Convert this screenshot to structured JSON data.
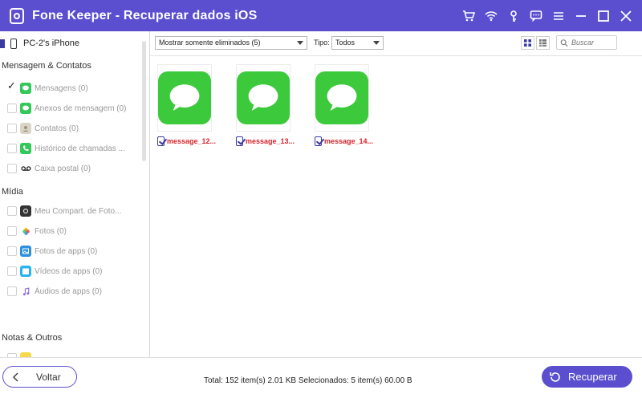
{
  "app": {
    "title": "Fone Keeper - Recuperar dados iOS",
    "accent_color": "#5b4fcf",
    "title_icons": [
      "cart-icon",
      "wifi-icon",
      "key-icon",
      "chat-icon",
      "menu-icon",
      "minimize-icon",
      "maximize-icon",
      "close-icon"
    ]
  },
  "sidebar": {
    "device_name": "PC-2's iPhone",
    "sections": {
      "messages": "Mensagem & Contatos",
      "media": "Mídia",
      "notes": "Notas & Outros"
    },
    "items": [
      {
        "label": "Mensagens (0)",
        "icon": "messages-icon",
        "checked": true
      },
      {
        "label": "Anexos de mensagem (0)",
        "icon": "message-attachments-icon",
        "checked": false
      },
      {
        "label": "Contatos (0)",
        "icon": "contacts-icon",
        "checked": false
      },
      {
        "label": "Histórico de chamadas ...",
        "icon": "phone-call-icon",
        "checked": false
      },
      {
        "label": "Caixa postal (0)",
        "icon": "voicemail-icon",
        "checked": false
      },
      {
        "label": "Meu Compart. de Foto...",
        "icon": "camera-icon",
        "checked": false
      },
      {
        "label": "Fotos (0)",
        "icon": "photos-icon",
        "checked": false
      },
      {
        "label": "Fotos de apps (0)",
        "icon": "app-photos-icon",
        "checked": false
      },
      {
        "label": "Vídeos de apps (0)",
        "icon": "video-icon",
        "checked": false
      },
      {
        "label": "Áudios de apps (0)",
        "icon": "music-icon",
        "checked": false
      }
    ]
  },
  "toolbar": {
    "filter_value": "Mostrar somente eliminados (5)",
    "type_label": "Tipo:",
    "type_value": "Todos",
    "search_placeholder": "Buscar"
  },
  "files": [
    {
      "name": "message_12...",
      "checked": true
    },
    {
      "name": "message_13...",
      "checked": true
    },
    {
      "name": "message_14...",
      "checked": true
    }
  ],
  "footer": {
    "back_label": "Voltar",
    "status": "Total: 152 item(s) 2.01 KB Selecionados: 5 item(s) 60.00 B",
    "recover_label": "Recuperar"
  }
}
